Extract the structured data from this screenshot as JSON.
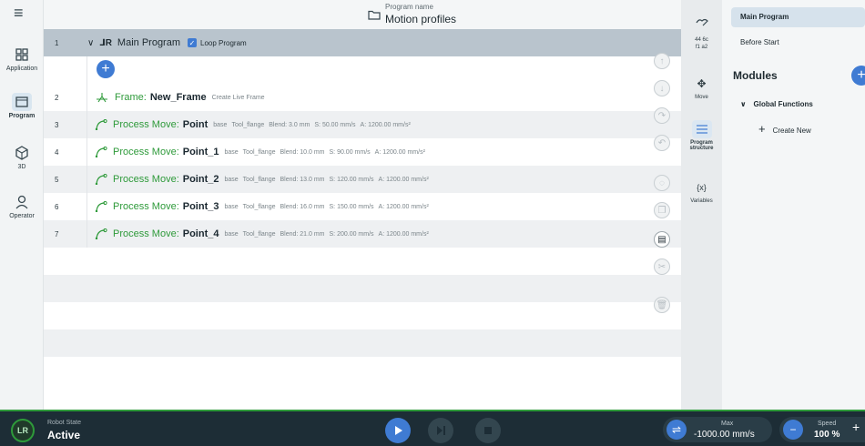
{
  "header": {
    "program_label": "Program name",
    "program_name": "Motion profiles"
  },
  "left_nav": {
    "items": [
      {
        "label": "Application"
      },
      {
        "label": "Program"
      },
      {
        "label": "3D"
      },
      {
        "label": "Operator"
      }
    ]
  },
  "program": {
    "main": {
      "num": "1",
      "title": "Main Program",
      "loop_label": "Loop Program"
    },
    "rows": [
      {
        "num": "2",
        "kind": "Frame:",
        "name": "New_Frame",
        "meta": [
          "Create Live Frame"
        ]
      },
      {
        "num": "3",
        "kind": "Process Move:",
        "name": "Point",
        "meta": [
          "base",
          "Tool_flange",
          "Blend: 3.0 mm",
          "S: 50.00 mm/s",
          "A: 1200.00 mm/s²"
        ]
      },
      {
        "num": "4",
        "kind": "Process Move:",
        "name": "Point_1",
        "meta": [
          "base",
          "Tool_flange",
          "Blend: 10.0 mm",
          "S: 90.00 mm/s",
          "A: 1200.00 mm/s²"
        ]
      },
      {
        "num": "5",
        "kind": "Process Move:",
        "name": "Point_2",
        "meta": [
          "base",
          "Tool_flange",
          "Blend: 13.0 mm",
          "S: 120.00 mm/s",
          "A: 1200.00 mm/s²"
        ]
      },
      {
        "num": "6",
        "kind": "Process Move:",
        "name": "Point_3",
        "meta": [
          "base",
          "Tool_flange",
          "Blend: 16.0 mm",
          "S: 150.00 mm/s",
          "A: 1200.00 mm/s²"
        ]
      },
      {
        "num": "7",
        "kind": "Process Move:",
        "name": "Point_4",
        "meta": [
          "base",
          "Tool_flange",
          "Blend: 21.0 mm",
          "S: 200.00 mm/s",
          "A: 1200.00 mm/s²"
        ]
      }
    ]
  },
  "rail": {
    "code": "44 6c\nf1 a2",
    "items": [
      {
        "label": "Move"
      },
      {
        "label": "Program structure"
      },
      {
        "label": "Variables"
      }
    ]
  },
  "panel": {
    "tab_main": "Main Program",
    "tab_before": "Before Start",
    "modules_title": "Modules",
    "global_functions": "Global Functions",
    "create_new": "Create New"
  },
  "bottom": {
    "robot_state_label": "Robot State",
    "robot_state_value": "Active",
    "logo_text": "LR",
    "max_label": "Max",
    "max_value": "-1000.00 mm/s",
    "speed_label": "Speed",
    "speed_value": "100 %"
  },
  "colors": {
    "accent": "#3f7bd3",
    "success": "#2e9a3a",
    "bar": "#1d2d36"
  }
}
